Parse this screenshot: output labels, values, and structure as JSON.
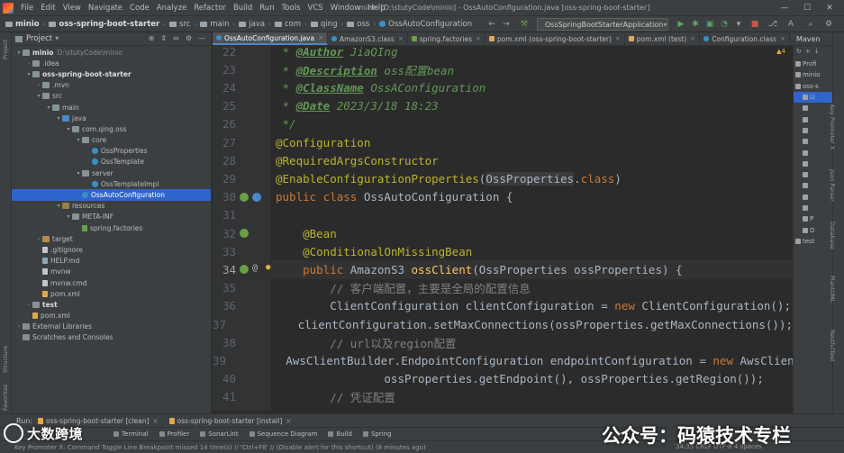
{
  "menu": [
    "File",
    "Edit",
    "View",
    "Navigate",
    "Code",
    "Analyze",
    "Refactor",
    "Build",
    "Run",
    "Tools",
    "VCS",
    "Window",
    "Help"
  ],
  "window_title": "minio [D:\\stutyCode\\minio] - OssAutoConfiguration.java [oss-spring-boot-starter]",
  "breadcrumbs": [
    "minio",
    "oss-spring-boot-starter",
    "src",
    "main",
    "java",
    "com",
    "qing",
    "oss",
    "OssAutoConfiguration"
  ],
  "run_config": "OssSpringBootStarterApplication",
  "project_panel": {
    "title": "Project",
    "tree": [
      {
        "depth": 0,
        "arrow": "▾",
        "icon": "folder",
        "label": "minio",
        "dim": "D:\\stutyCode\\minio",
        "bold": true
      },
      {
        "depth": 1,
        "arrow": "›",
        "icon": "folder",
        "label": ".idea"
      },
      {
        "depth": 1,
        "arrow": "▾",
        "icon": "folder",
        "label": "oss-spring-boot-starter",
        "bold": true
      },
      {
        "depth": 2,
        "arrow": "›",
        "icon": "folder",
        "label": ".mvn"
      },
      {
        "depth": 2,
        "arrow": "▾",
        "icon": "folder",
        "label": "src"
      },
      {
        "depth": 3,
        "arrow": "▾",
        "icon": "folder",
        "label": "main"
      },
      {
        "depth": 4,
        "arrow": "▾",
        "icon": "src",
        "label": "java"
      },
      {
        "depth": 5,
        "arrow": "▾",
        "icon": "folder",
        "label": "com.qing.oss"
      },
      {
        "depth": 6,
        "arrow": "▾",
        "icon": "folder",
        "label": "core"
      },
      {
        "depth": 7,
        "arrow": "",
        "icon": "class",
        "label": "OssProperties"
      },
      {
        "depth": 7,
        "arrow": "",
        "icon": "class",
        "label": "OssTemplate"
      },
      {
        "depth": 6,
        "arrow": "▾",
        "icon": "folder",
        "label": "server"
      },
      {
        "depth": 7,
        "arrow": "",
        "icon": "class",
        "label": "OssTemplateImpl"
      },
      {
        "depth": 6,
        "arrow": "",
        "icon": "class",
        "label": "OssAutoConfiguration",
        "selected": true
      },
      {
        "depth": 4,
        "arrow": "▾",
        "icon": "res",
        "label": "resources"
      },
      {
        "depth": 5,
        "arrow": "▾",
        "icon": "folder",
        "label": "META-INF"
      },
      {
        "depth": 6,
        "arrow": "",
        "icon": "spring",
        "label": "spring.factories"
      },
      {
        "depth": 2,
        "arrow": "›",
        "icon": "excl",
        "label": "target"
      },
      {
        "depth": 2,
        "arrow": "",
        "icon": "file",
        "label": ".gitignore"
      },
      {
        "depth": 2,
        "arrow": "",
        "icon": "md",
        "label": "HELP.md"
      },
      {
        "depth": 2,
        "arrow": "",
        "icon": "file",
        "label": "mvnw"
      },
      {
        "depth": 2,
        "arrow": "",
        "icon": "file",
        "label": "mvnw.cmd"
      },
      {
        "depth": 2,
        "arrow": "",
        "icon": "xml",
        "label": "pom.xml"
      },
      {
        "depth": 1,
        "arrow": "›",
        "icon": "folder",
        "label": "test",
        "bold": true
      },
      {
        "depth": 1,
        "arrow": "",
        "icon": "xml",
        "label": "pom.xml"
      },
      {
        "depth": 0,
        "arrow": "›",
        "icon": "lib",
        "label": "External Libraries"
      },
      {
        "depth": 0,
        "arrow": "",
        "icon": "lib",
        "label": "Scratches and Consoles"
      }
    ]
  },
  "editor_tabs": [
    {
      "label": "OssAutoConfiguration.java",
      "icon": "c",
      "active": true
    },
    {
      "label": "AmazonS3.class",
      "icon": "c"
    },
    {
      "label": "spring.factories",
      "icon": "s"
    },
    {
      "label": "pom.xml (oss-spring-boot-starter)",
      "icon": "m"
    },
    {
      "label": "pom.xml (test)",
      "icon": "m"
    },
    {
      "label": "Configuration.class",
      "icon": "c"
    }
  ],
  "maven": {
    "title": "Maven",
    "items": [
      "Profi",
      "minio",
      "oss-s",
      "Li",
      "",
      "",
      "",
      "",
      "",
      "",
      "",
      "",
      "",
      "",
      "P",
      "D",
      "test"
    ]
  },
  "inspections": "▲4",
  "code_lines": [
    {
      "n": "22",
      "tokens": [
        [
          "doc",
          " * "
        ],
        [
          "doctag",
          "@Author"
        ],
        [
          "doc",
          " JiaQIng"
        ]
      ]
    },
    {
      "n": "23",
      "tokens": [
        [
          "doc",
          " * "
        ],
        [
          "doctag",
          "@Description"
        ],
        [
          "doc",
          " oss配置bean"
        ]
      ]
    },
    {
      "n": "24",
      "tokens": [
        [
          "doc",
          " * "
        ],
        [
          "doctag",
          "@ClassName"
        ],
        [
          "doc",
          " OssAConfiguration"
        ]
      ]
    },
    {
      "n": "25",
      "tokens": [
        [
          "doc",
          " * "
        ],
        [
          "doctag",
          "@Date"
        ],
        [
          "doc",
          " 2023/3/18 18:23"
        ]
      ]
    },
    {
      "n": "26",
      "tokens": [
        [
          "doc",
          " */"
        ]
      ]
    },
    {
      "n": "27",
      "tokens": [
        [
          "ann",
          "@Configuration"
        ]
      ]
    },
    {
      "n": "28",
      "tokens": [
        [
          "ann",
          "@RequiredArgsConstructor"
        ]
      ]
    },
    {
      "n": "29",
      "tokens": [
        [
          "ann",
          "@EnableConfigurationProperties"
        ],
        [
          "cls",
          "("
        ],
        [
          "hlcls",
          "OssProperties"
        ],
        [
          "cls",
          "."
        ],
        [
          "kw",
          "class"
        ],
        [
          "cls",
          ")"
        ]
      ]
    },
    {
      "n": "30",
      "mark": "bean",
      "tokens": [
        [
          "kw",
          "public class "
        ],
        [
          "cls",
          "OssAutoConfiguration {"
        ]
      ]
    },
    {
      "n": "31",
      "tokens": []
    },
    {
      "n": "32",
      "mark": "bean",
      "tokens": [
        [
          "cls",
          "    "
        ],
        [
          "ann",
          "@Bean"
        ]
      ]
    },
    {
      "n": "33",
      "tokens": [
        [
          "cls",
          "    "
        ],
        [
          "ann",
          "@ConditionalOnMissingBean"
        ]
      ]
    },
    {
      "n": "34",
      "mark": "bean-at-bulb",
      "current": true,
      "tokens": [
        [
          "cls",
          "    "
        ],
        [
          "kw",
          "public "
        ],
        [
          "cls",
          "AmazonS3 "
        ],
        [
          "fn",
          "ossClient"
        ],
        [
          "cls",
          "(OssProperties ossProperties) {"
        ]
      ]
    },
    {
      "n": "35",
      "tokens": [
        [
          "cls",
          "        "
        ],
        [
          "cm",
          "// 客户端配置，主要是全局的配置信息"
        ]
      ]
    },
    {
      "n": "36",
      "tokens": [
        [
          "cls",
          "        ClientConfiguration clientConfiguration = "
        ],
        [
          "kw",
          "new "
        ],
        [
          "cls",
          "ClientConfiguration();"
        ]
      ]
    },
    {
      "n": "37",
      "tokens": [
        [
          "cls",
          "        clientConfiguration.setMaxConnections(ossProperties.getMaxConnections());"
        ]
      ]
    },
    {
      "n": "38",
      "tokens": [
        [
          "cls",
          "        "
        ],
        [
          "cm",
          "// url以及region配置"
        ]
      ]
    },
    {
      "n": "39",
      "tokens": [
        [
          "cls",
          "        AwsClientBuilder.EndpointConfiguration endpointConfiguration = "
        ],
        [
          "kw",
          "new "
        ],
        [
          "cls",
          "AwsClientBuilder"
        ]
      ]
    },
    {
      "n": "40",
      "tokens": [
        [
          "cls",
          "                ossProperties.getEndpoint(), ossProperties.getRegion());"
        ]
      ]
    },
    {
      "n": "41",
      "tokens": [
        [
          "cls",
          "        "
        ],
        [
          "cm",
          "// 凭证配置"
        ]
      ]
    }
  ],
  "run_bar": {
    "label": "Run:",
    "tabs": [
      "oss-spring-boot-starter [clean]",
      "oss-spring-boot-starter [install]"
    ]
  },
  "tool_buttons": [
    "Terminal",
    "Profiler",
    "SonarLint",
    "Sequence Diagram",
    "Build",
    "Spring"
  ],
  "status": "Key Promoter X: Command Toggle Line Breakpoint missed 14 time(s) // 'Ctrl+F8' // (Disable alert for this shortcut) (8 minutes ago)",
  "status_right": "34:35   CRLF   UTF-8   4 spaces",
  "left_stripe": [
    "Project",
    "Structure",
    "Favorites"
  ],
  "right_stripe": [
    "Maven",
    "Key Promoter X",
    "Json Parser",
    "Database",
    "Bean Validation",
    "PlantUML",
    "RestfulTool"
  ],
  "watermark_left": "大数跨境",
  "watermark_right": "公众号：码猿技术专栏"
}
